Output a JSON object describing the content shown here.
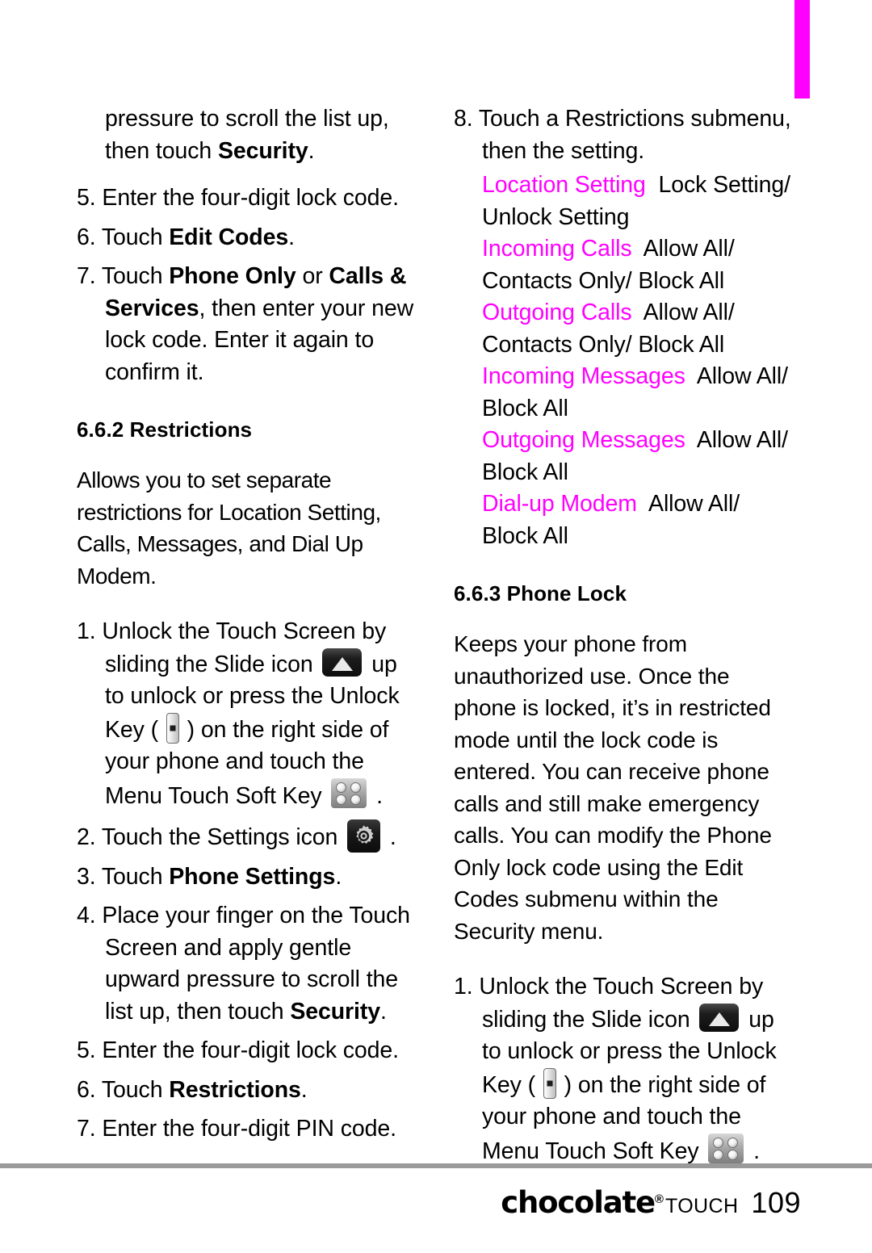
{
  "page": {
    "number": "109",
    "brand": "chocolate",
    "brand_registered_mark": "®",
    "brand_suffix": "TOUCH",
    "tab_marker_color": "#ff00ff",
    "accent_color": "#ff00ff",
    "rule_color": "#9a9a9a"
  },
  "left_column": {
    "carryover_step": {
      "line1": "pressure to scroll the list up,",
      "line2_prefix": "then touch ",
      "line2_bold": "Security",
      "line2_suffix": "."
    },
    "steps_edit_codes": [
      {
        "number": "5.",
        "text": "Enter the four-digit lock code."
      },
      {
        "number": "6.",
        "prefix": "Touch ",
        "bold": "Edit Codes",
        "suffix": "."
      },
      {
        "number": "7.",
        "prefix": "Touch ",
        "bold1": "Phone Only",
        "mid1": " or ",
        "bold2": "Calls & Services",
        "suffix": ", then enter your new lock code. Enter it again to confirm it."
      }
    ],
    "section_restrictions": {
      "heading": "6.6.2 Restrictions",
      "intro": "Allows you to set separate restrictions for Location Setting, Calls, Messages, and Dial Up Modem.",
      "steps": [
        {
          "number": "1.",
          "part1": "Unlock the Touch Screen by sliding the Slide icon ",
          "icon1": "slide-icon",
          "part2": " up to unlock or press the Unlock Key ( ",
          "icon2": "unlock-key-icon",
          "part3": " ) on the right side of your phone and touch the Menu Touch Soft Key ",
          "icon3": "menu-soft-key-icon",
          "part4": " ."
        },
        {
          "number": "2.",
          "part1": "Touch the Settings icon ",
          "icon1": "settings-gear-icon",
          "part2": " ."
        },
        {
          "number": "3.",
          "prefix": "Touch ",
          "bold": "Phone Settings",
          "suffix": "."
        },
        {
          "number": "4.",
          "prefix": "Place your finger on the Touch Screen and apply gentle upward pressure to scroll the list up, then touch ",
          "bold": "Security",
          "suffix": "."
        },
        {
          "number": "5.",
          "text": "Enter the four-digit lock code."
        },
        {
          "number": "6.",
          "prefix": "Touch ",
          "bold": "Restrictions",
          "suffix": "."
        },
        {
          "number": "7.",
          "text": "Enter the four-digit PIN code."
        }
      ]
    }
  },
  "right_column": {
    "step8": {
      "number": "8.",
      "text": "Touch a Restrictions submenu, then the setting."
    },
    "restrictions_submenus": [
      {
        "label": "Location Setting",
        "options": "Lock Setting/ Unlock Setting"
      },
      {
        "label": "Incoming Calls",
        "options": "Allow All/ Contacts Only/ Block All"
      },
      {
        "label": "Outgoing Calls",
        "options": "Allow All/ Contacts Only/ Block All"
      },
      {
        "label": "Incoming Messages",
        "options": "Allow All/ Block All"
      },
      {
        "label": "Outgoing Messages",
        "options": "Allow All/ Block All"
      },
      {
        "label": "Dial-up Modem",
        "options": "Allow All/ Block All"
      }
    ],
    "section_phone_lock": {
      "heading": "6.6.3 Phone Lock",
      "intro": "Keeps your phone from unauthorized use. Once the phone is locked, it’s in restricted mode until the lock code is entered. You can receive phone calls and still make emergency calls. You can modify the Phone Only lock code using the Edit Codes submenu within the Security menu.",
      "steps": [
        {
          "number": "1.",
          "part1": "Unlock the Touch Screen by sliding the Slide icon ",
          "icon1": "slide-icon",
          "part2": " up to unlock or press the Unlock Key ( ",
          "icon2": "unlock-key-icon",
          "part3": " ) on the right side of your phone and touch the Menu Touch Soft Key ",
          "icon3": "menu-soft-key-icon",
          "part4": " ."
        }
      ]
    }
  }
}
